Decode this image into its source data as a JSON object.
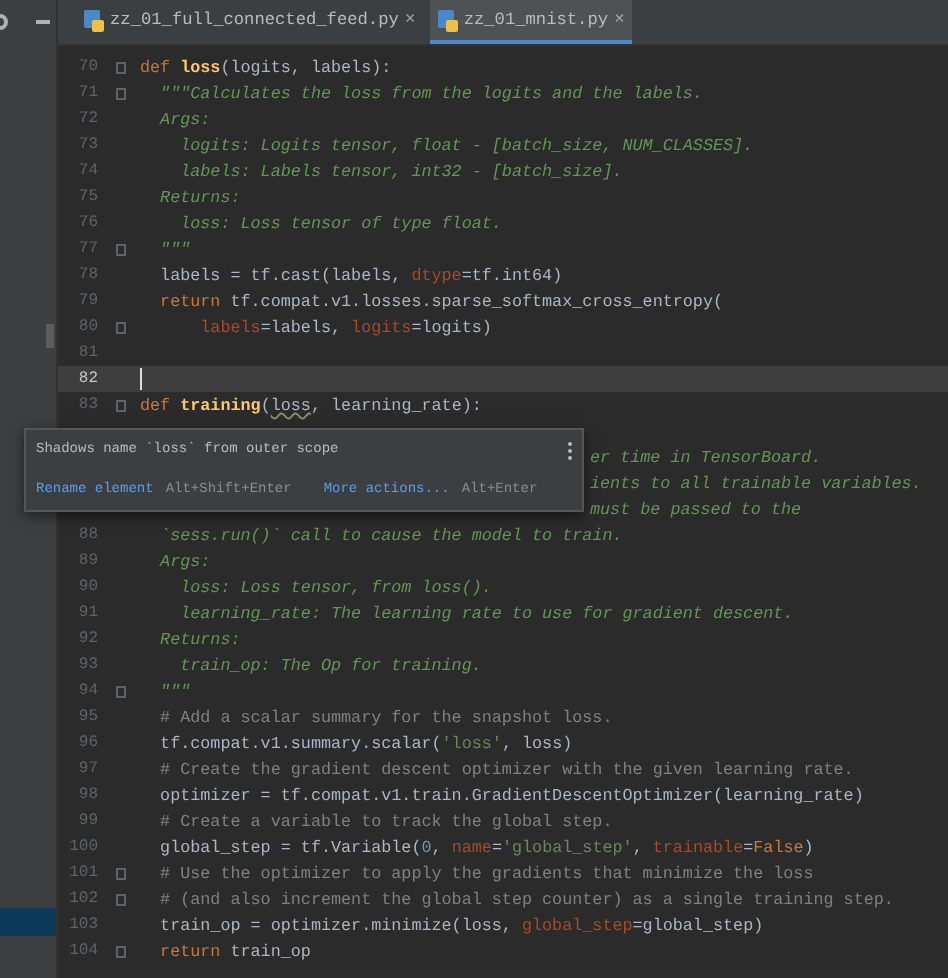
{
  "tabs": [
    {
      "label": "zz_01_full_connected_feed.py",
      "close": "×",
      "selected": false
    },
    {
      "label": "zz_01_mnist.py",
      "close": "×",
      "selected": true
    }
  ],
  "editor": {
    "lines": [
      {
        "number": "70",
        "fold": true,
        "current": false,
        "tokens": [
          {
            "kind": "kw",
            "text": "def "
          },
          {
            "kind": "fn",
            "text": "loss"
          },
          {
            "kind": "plain",
            "text": "(logits, labels):"
          }
        ]
      },
      {
        "number": "71",
        "fold": true,
        "current": false,
        "tokens": [
          {
            "kind": "doc",
            "text": "  \"\"\"Calculates the loss from the logits and the labels."
          }
        ]
      },
      {
        "number": "72",
        "fold": false,
        "current": false,
        "tokens": [
          {
            "kind": "doc",
            "text": "  Args:"
          }
        ]
      },
      {
        "number": "73",
        "fold": false,
        "current": false,
        "tokens": [
          {
            "kind": "doc",
            "text": "    logits: Logits tensor, float - [batch_size, NUM_CLASSES]."
          }
        ]
      },
      {
        "number": "74",
        "fold": false,
        "current": false,
        "tokens": [
          {
            "kind": "doc",
            "text": "    labels: Labels tensor, int32 - [batch_size]."
          }
        ]
      },
      {
        "number": "75",
        "fold": false,
        "current": false,
        "tokens": [
          {
            "kind": "doc",
            "text": "  Returns:"
          }
        ]
      },
      {
        "number": "76",
        "fold": false,
        "current": false,
        "tokens": [
          {
            "kind": "doc",
            "text": "    loss: Loss tensor of type float."
          }
        ]
      },
      {
        "number": "77",
        "fold": true,
        "current": false,
        "tokens": [
          {
            "kind": "doc",
            "text": "  \"\"\""
          }
        ]
      },
      {
        "number": "78",
        "fold": false,
        "current": false,
        "tokens": [
          {
            "kind": "plain",
            "text": "  labels = tf.cast(labels, "
          },
          {
            "kind": "param",
            "text": "dtype"
          },
          {
            "kind": "plain",
            "text": "=tf.int64)"
          }
        ]
      },
      {
        "number": "79",
        "fold": false,
        "current": false,
        "tokens": [
          {
            "kind": "kw",
            "text": "  return "
          },
          {
            "kind": "plain",
            "text": "tf.compat.v1.losses.sparse_softmax_cross_entropy("
          }
        ]
      },
      {
        "number": "80",
        "fold": true,
        "current": false,
        "tokens": [
          {
            "kind": "param",
            "text": "      labels"
          },
          {
            "kind": "plain",
            "text": "=labels, "
          },
          {
            "kind": "param",
            "text": "logits"
          },
          {
            "kind": "plain",
            "text": "=logits)"
          }
        ]
      },
      {
        "number": "81",
        "fold": false,
        "current": false
      },
      {
        "number": "82",
        "fold": false,
        "current": true
      },
      {
        "number": "83",
        "fold": true,
        "current": false,
        "tokens": [
          {
            "kind": "kw",
            "text": "def "
          },
          {
            "kind": "fn",
            "text": "training"
          },
          {
            "kind": "plain",
            "text": "("
          },
          {
            "kind": "warn",
            "text": "loss"
          },
          {
            "kind": "plain",
            "text": ", learning_rate):"
          }
        ]
      },
      {
        "current": false,
        "covered": true
      },
      {
        "current": false,
        "covered": true,
        "tokens": [
          {
            "kind": "doc",
            "text": "er time in TensorBoard."
          }
        ]
      },
      {
        "current": false,
        "covered": true,
        "tokens": [
          {
            "kind": "doc",
            "text": "ients to all trainable variables."
          }
        ]
      },
      {
        "current": false,
        "covered": true,
        "tokens": [
          {
            "kind": "doc",
            "text": "must be passed to the"
          }
        ]
      },
      {
        "number": "88",
        "fold": false,
        "current": false,
        "tokens": [
          {
            "kind": "doc",
            "text": "  `sess.run()` call to cause the model to train."
          }
        ]
      },
      {
        "number": "89",
        "fold": false,
        "current": false,
        "tokens": [
          {
            "kind": "doc",
            "text": "  Args:"
          }
        ]
      },
      {
        "number": "90",
        "fold": false,
        "current": false,
        "tokens": [
          {
            "kind": "doc",
            "text": "    loss: Loss tensor, from loss()."
          }
        ]
      },
      {
        "number": "91",
        "fold": false,
        "current": false,
        "tokens": [
          {
            "kind": "doc",
            "text": "    learning_rate: The learning rate to use for gradient descent."
          }
        ]
      },
      {
        "number": "92",
        "fold": false,
        "current": false,
        "tokens": [
          {
            "kind": "doc",
            "text": "  Returns:"
          }
        ]
      },
      {
        "number": "93",
        "fold": false,
        "current": false,
        "tokens": [
          {
            "kind": "doc",
            "text": "    train_op: The Op for training."
          }
        ]
      },
      {
        "number": "94",
        "fold": true,
        "current": false,
        "tokens": [
          {
            "kind": "doc",
            "text": "  \"\"\""
          }
        ]
      },
      {
        "number": "95",
        "fold": false,
        "current": false,
        "tokens": [
          {
            "kind": "comment",
            "text": "  # Add a scalar summary for the snapshot loss."
          }
        ]
      },
      {
        "number": "96",
        "fold": false,
        "current": false,
        "tokens": [
          {
            "kind": "plain",
            "text": "  tf.compat.v1.summary.scalar("
          },
          {
            "kind": "str",
            "text": "'loss'"
          },
          {
            "kind": "plain",
            "text": ", loss)"
          }
        ]
      },
      {
        "number": "97",
        "fold": false,
        "current": false,
        "tokens": [
          {
            "kind": "comment",
            "text": "  # Create the gradient descent optimizer with the given learning rate."
          }
        ]
      },
      {
        "number": "98",
        "fold": false,
        "current": false,
        "tokens": [
          {
            "kind": "plain",
            "text": "  optimizer = tf.compat.v1.train.GradientDescentOptimizer(learning_rate)"
          }
        ]
      },
      {
        "number": "99",
        "fold": false,
        "current": false,
        "tokens": [
          {
            "kind": "comment",
            "text": "  # Create a variable to track the global step."
          }
        ]
      },
      {
        "number": "100",
        "fold": false,
        "current": false,
        "tokens": [
          {
            "kind": "plain",
            "text": "  global_step = tf.Variable("
          },
          {
            "kind": "num",
            "text": "0"
          },
          {
            "kind": "plain",
            "text": ", "
          },
          {
            "kind": "param",
            "text": "name"
          },
          {
            "kind": "plain",
            "text": "="
          },
          {
            "kind": "str",
            "text": "'global_step'"
          },
          {
            "kind": "plain",
            "text": ", "
          },
          {
            "kind": "param",
            "text": "trainable"
          },
          {
            "kind": "plain",
            "text": "="
          },
          {
            "kind": "kw",
            "text": "False"
          },
          {
            "kind": "plain",
            "text": ")"
          }
        ]
      },
      {
        "number": "101",
        "fold": true,
        "current": false,
        "tokens": [
          {
            "kind": "comment",
            "text": "  # Use the optimizer to apply the gradients that minimize the loss"
          }
        ]
      },
      {
        "number": "102",
        "fold": true,
        "current": false,
        "tokens": [
          {
            "kind": "comment",
            "text": "  # (and also increment the global step counter) as a single training step."
          }
        ]
      },
      {
        "number": "103",
        "fold": false,
        "current": false,
        "tokens": [
          {
            "kind": "plain",
            "text": "  train_op = optimizer.minimize(loss, "
          },
          {
            "kind": "param",
            "text": "global_step"
          },
          {
            "kind": "plain",
            "text": "=global_step)"
          }
        ]
      },
      {
        "number": "104",
        "fold": true,
        "current": false,
        "tokens": [
          {
            "kind": "kw",
            "text": "  return "
          },
          {
            "kind": "plain",
            "text": "train_op"
          }
        ]
      }
    ]
  },
  "popup": {
    "message": "Shadows name `loss` from outer scope",
    "actions": [
      {
        "label": "Rename element",
        "shortcut": "Alt+Shift+Enter"
      },
      {
        "label": "More actions...",
        "shortcut": "Alt+Enter"
      }
    ]
  }
}
